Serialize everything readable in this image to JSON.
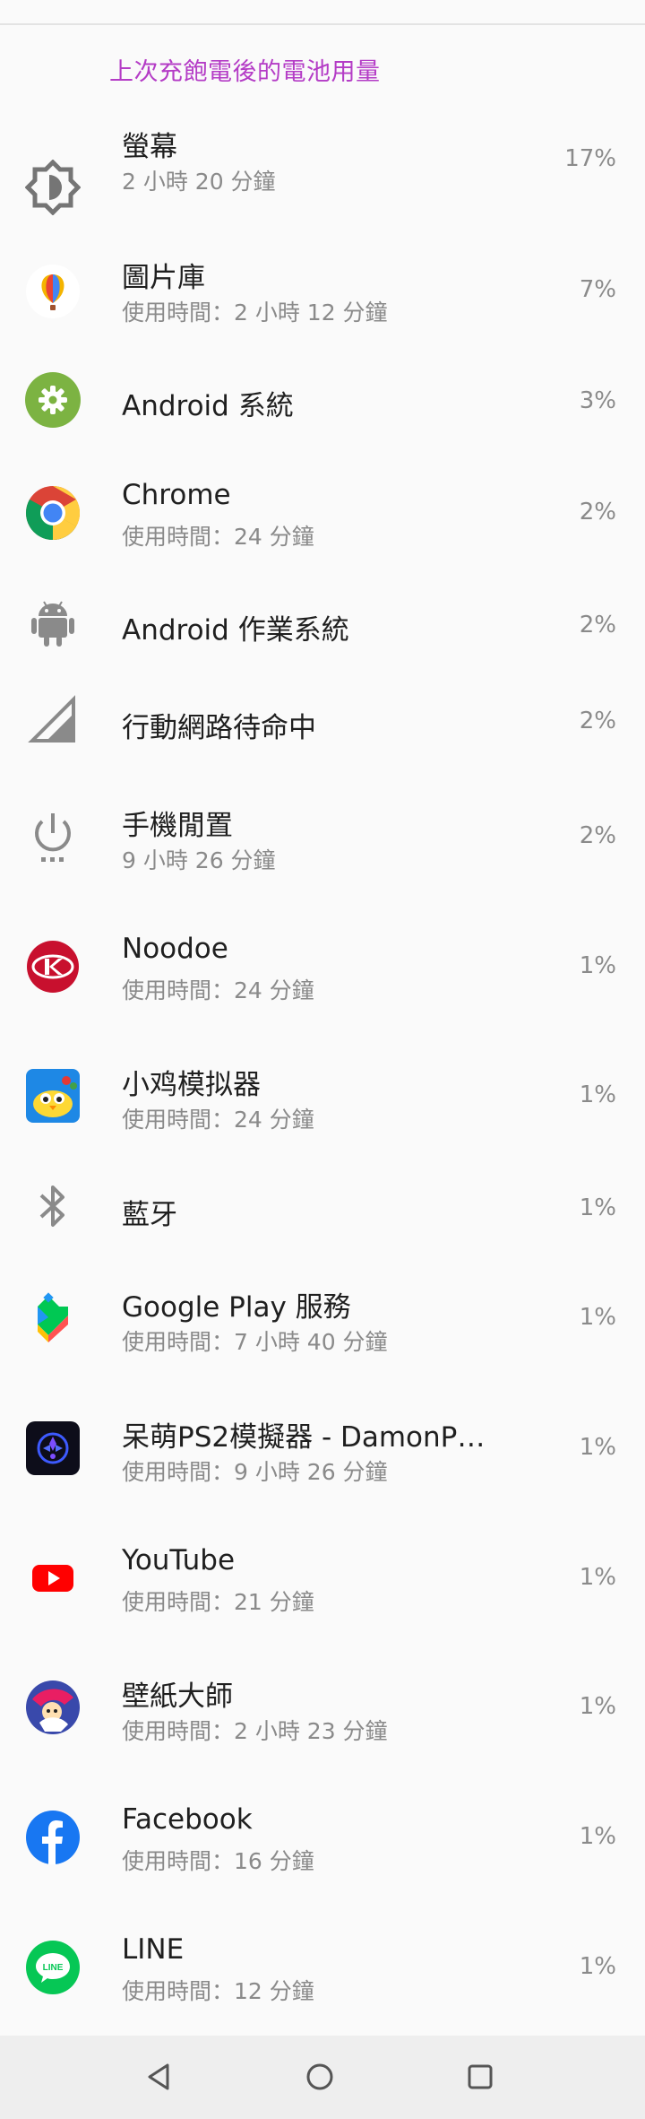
{
  "section_header": "上次充飽電後的電池用量",
  "apps": [
    {
      "icon": "screen-brightness-icon",
      "title": "螢幕",
      "subtitle": "2 小時 20 分鐘",
      "percent": "17%"
    },
    {
      "icon": "gallery-balloon-icon",
      "title": "圖片庫",
      "subtitle": "使用時間：2 小時 12 分鐘",
      "percent": "7%"
    },
    {
      "icon": "android-system-gear-icon",
      "title": "Android 系統",
      "subtitle": "",
      "percent": "3%"
    },
    {
      "icon": "chrome-icon",
      "title": "Chrome",
      "subtitle": "使用時間：24 分鐘",
      "percent": "2%"
    },
    {
      "icon": "android-robot-icon",
      "title": "Android 作業系統",
      "subtitle": "",
      "percent": "2%"
    },
    {
      "icon": "cell-signal-icon",
      "title": "行動網路待命中",
      "subtitle": "",
      "percent": "2%"
    },
    {
      "icon": "power-idle-icon",
      "title": "手機閒置",
      "subtitle": "9 小時 26 分鐘",
      "percent": "2%"
    },
    {
      "icon": "noodoe-icon",
      "title": "Noodoe",
      "subtitle": "使用時間：24 分鐘",
      "percent": "1%"
    },
    {
      "icon": "chick-emulator-icon",
      "title": "小鸡模拟器",
      "subtitle": "使用時間：24 分鐘",
      "percent": "1%"
    },
    {
      "icon": "bluetooth-icon",
      "title": "藍牙",
      "subtitle": "",
      "percent": "1%"
    },
    {
      "icon": "google-play-services-icon",
      "title": "Google Play 服務",
      "subtitle": "使用時間：7 小時 40 分鐘",
      "percent": "1%"
    },
    {
      "icon": "damonps2-icon",
      "title": "呆萌PS2模擬器 - DamonP…",
      "subtitle": "使用時間：9 小時 26 分鐘",
      "percent": "1%"
    },
    {
      "icon": "youtube-icon",
      "title": "YouTube",
      "subtitle": "使用時間：21 分鐘",
      "percent": "1%"
    },
    {
      "icon": "wallpaper-master-icon",
      "title": "壁紙大師",
      "subtitle": "使用時間：2 小時 23 分鐘",
      "percent": "1%"
    },
    {
      "icon": "facebook-icon",
      "title": "Facebook",
      "subtitle": "使用時間：16 分鐘",
      "percent": "1%"
    },
    {
      "icon": "line-icon",
      "title": "LINE",
      "subtitle": "使用時間：12 分鐘",
      "percent": "1%"
    }
  ],
  "navbar": {
    "back": "back-icon",
    "home": "home-icon",
    "recents": "recents-icon"
  }
}
